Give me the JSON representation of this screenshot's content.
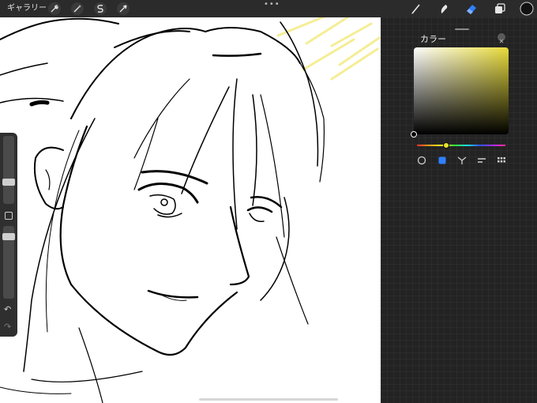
{
  "topbar": {
    "gallery_label": "ギャラリー",
    "actions_icon": "wrench-icon",
    "adjustments_icon": "magic-wand-icon",
    "selection_icon": "selection-s-icon",
    "transform_icon": "arrow-cursor-icon",
    "more_label": "•••",
    "brush_icon": "brush-icon",
    "smudge_icon": "smudge-icon",
    "eraser_icon": "eraser-icon",
    "layers_icon": "layers-icon",
    "current_color": "#111111",
    "active_tool_color": "#2f7fff"
  },
  "color_panel": {
    "title": "カラー",
    "hue_color": "#e8db3a",
    "selected_color": "#000000",
    "modes": [
      "disc",
      "classic",
      "harmony",
      "value",
      "palettes"
    ],
    "active_mode": "classic",
    "active_mode_color": "#2f7fff"
  },
  "sidebar": {
    "modify_icon": "square-modify-icon",
    "undo_label": "↶",
    "redo_label": "↷"
  },
  "canvas": {
    "content": "line-art-illustration"
  }
}
